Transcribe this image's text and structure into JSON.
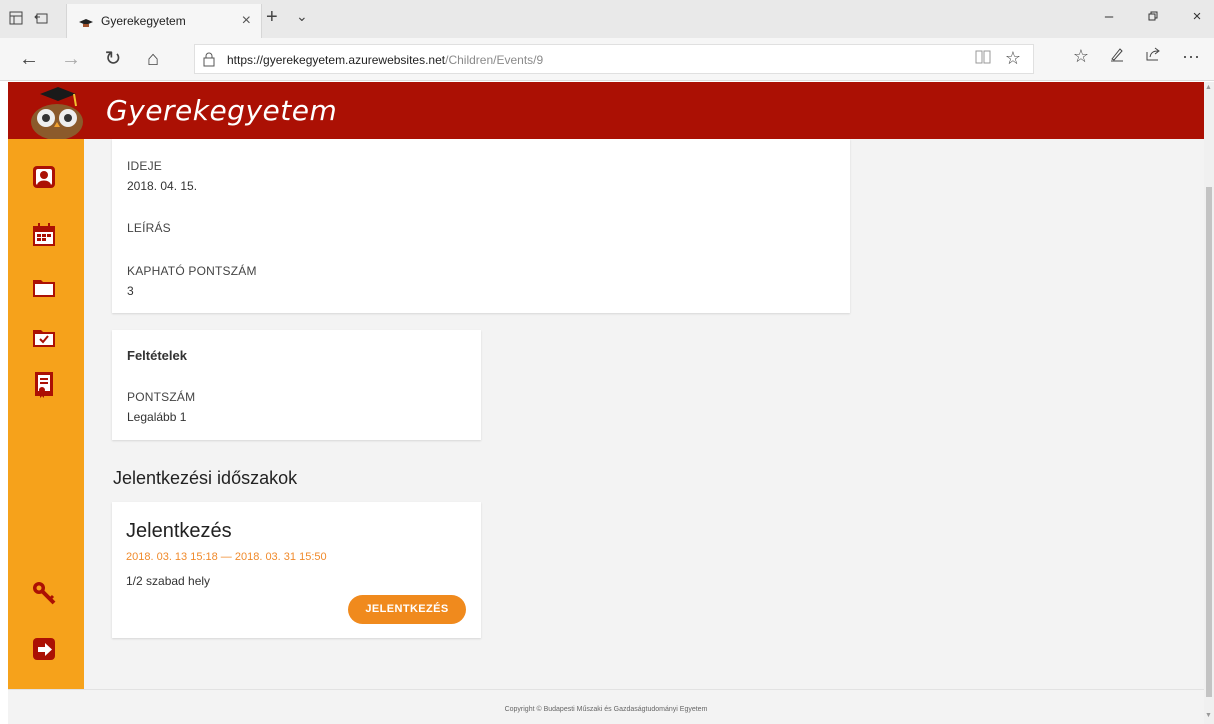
{
  "browser": {
    "tab_title": "Gyerekegyetem",
    "url_host": "https://gyerekegyetem.azurewebsites.net",
    "url_path": "/Children/Events/9"
  },
  "site": {
    "title": "Gyerekegyetem",
    "brand_color": "#ab1004",
    "sidebar_color": "#f6a21b",
    "accent_color": "#f08a1d"
  },
  "event": {
    "date_label": "IDEJE",
    "date_value": "2018. 04. 15.",
    "description_label": "LEÍRÁS",
    "points_label": "KAPHATÓ PONTSZÁM",
    "points_value": "3"
  },
  "conditions": {
    "title": "Feltételek",
    "score_label": "PONTSZÁM",
    "score_value": "Legalább 1"
  },
  "registration": {
    "section_title": "Jelentkezési időszakok",
    "card_title": "Jelentkezés",
    "dates": "2018. 03. 13 15:18 — 2018. 03. 31 15:50",
    "seats": "1/2 szabad hely",
    "button_label": "JELENTKEZÉS"
  },
  "footer": {
    "copyright": "Copyright © Budapesti Műszaki és Gazdaságtudományi Egyetem"
  },
  "icons": [
    "tab-list-icon",
    "back-tab-icon",
    "graduation-cap-favicon-icon",
    "close-icon",
    "new-tab-icon",
    "chevron-down-icon",
    "minimize-icon",
    "restore-icon",
    "window-close-icon",
    "back-icon",
    "forward-icon",
    "refresh-icon",
    "home-icon",
    "lock-icon",
    "reading-view-icon",
    "favorite-star-icon",
    "favorites-list-icon",
    "pen-icon",
    "share-icon",
    "more-icon",
    "profile-icon",
    "calendar-icon",
    "folder-icon",
    "folder-check-icon",
    "certificate-icon",
    "key-icon",
    "logout-icon"
  ]
}
